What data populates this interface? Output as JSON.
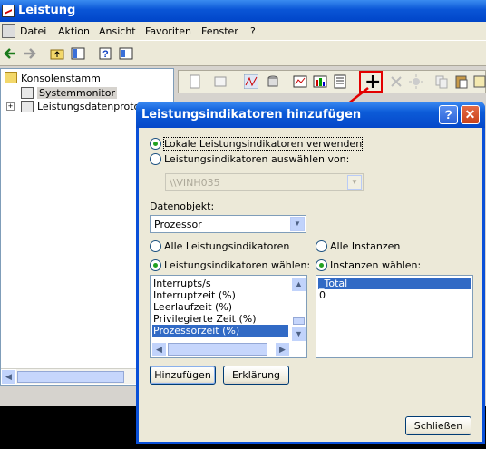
{
  "main_window": {
    "title": "Leistung"
  },
  "menu": [
    "Datei",
    "Aktion",
    "Ansicht",
    "Favoriten",
    "Fenster",
    "?"
  ],
  "tree": {
    "root": "Konsolenstamm",
    "items": [
      "Systemmonitor",
      "Leistungsdatenprotoko"
    ]
  },
  "dialog": {
    "title": "Leistungsindikatoren hinzufügen",
    "help_label": "?",
    "close_label": "✕",
    "radio_local": "Lokale Leistungsindikatoren verwenden",
    "radio_select_from": "Leistungsindikatoren auswählen von:",
    "computer_value": "\\\\VINH035",
    "object_label": "Datenobjekt:",
    "object_value": "Prozessor",
    "radio_all_counters": "Alle Leistungsindikatoren",
    "radio_select_counters": "Leistungsindikatoren wählen:",
    "radio_all_instances": "Alle Instanzen",
    "radio_select_instances": "Instanzen wählen:",
    "counters": [
      "Interrupts/s",
      "Interruptzeit (%)",
      "Leerlaufzeit (%)",
      "Privilegierte Zeit (%)",
      "Prozessorzeit (%)"
    ],
    "selected_counter": "Prozessorzeit (%)",
    "instances": [
      "_Total",
      "0"
    ],
    "selected_instance": "_Total",
    "add_button": "Hinzufügen",
    "explain_button": "Erklärung",
    "close_button": "Schließen"
  },
  "colors": {
    "highlight": "#e30000",
    "title_blue": "#0a55d6",
    "selection": "#316ac5"
  }
}
